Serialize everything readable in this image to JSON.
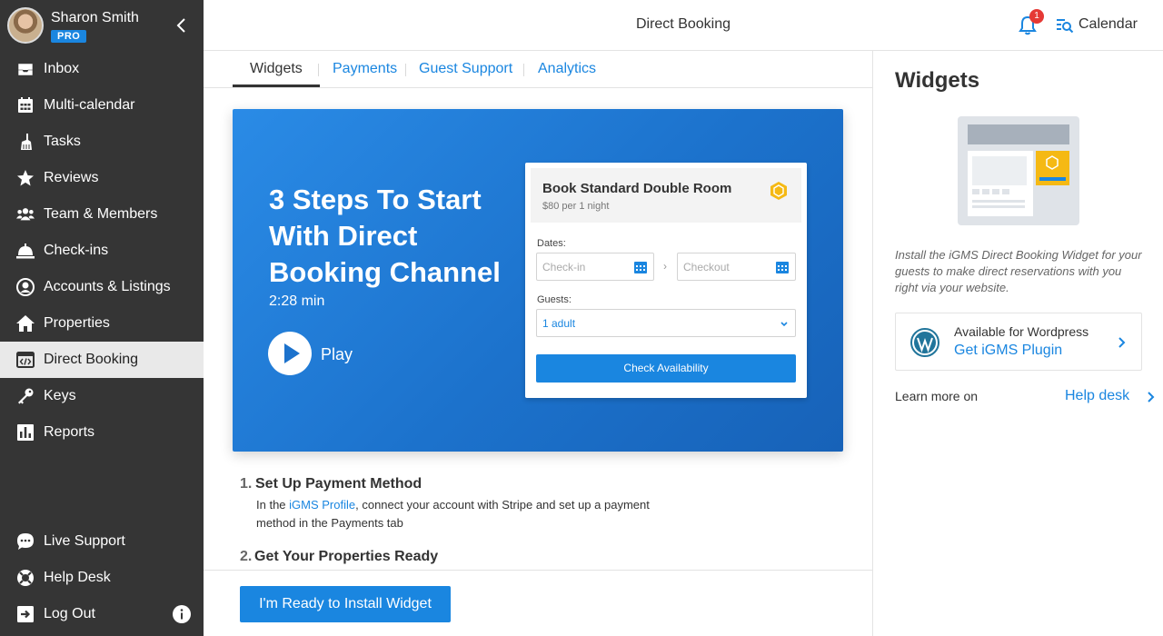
{
  "user": {
    "name": "Sharon Smith",
    "badge": "PRO"
  },
  "nav": {
    "items": [
      {
        "label": "Inbox",
        "icon": "inbox-icon"
      },
      {
        "label": "Multi-calendar",
        "icon": "calendar-grid-icon"
      },
      {
        "label": "Tasks",
        "icon": "broom-icon"
      },
      {
        "label": "Reviews",
        "icon": "star-icon"
      },
      {
        "label": "Team & Members",
        "icon": "users-icon"
      },
      {
        "label": "Check-ins",
        "icon": "service-bell-icon"
      },
      {
        "label": "Accounts & Listings",
        "icon": "account-circle-icon"
      },
      {
        "label": "Properties",
        "icon": "home-icon"
      },
      {
        "label": "Direct Booking",
        "icon": "browser-code-icon",
        "active": true
      },
      {
        "label": "Keys",
        "icon": "key-icon"
      },
      {
        "label": "Reports",
        "icon": "bar-chart-icon"
      }
    ],
    "bottom": [
      {
        "label": "Live Support",
        "icon": "chat-icon"
      },
      {
        "label": "Help Desk",
        "icon": "lifebuoy-icon"
      },
      {
        "label": "Log Out",
        "icon": "logout-icon"
      }
    ]
  },
  "header": {
    "title": "Direct Booking",
    "notification_count": "1",
    "calendar_label": "Calendar"
  },
  "tabs": [
    "Widgets",
    "Payments",
    "Guest Support",
    "Analytics"
  ],
  "hero": {
    "title": "3 Steps To Start With Direct Booking Channel",
    "duration": "2:28 min",
    "play_label": "Play",
    "widget": {
      "room": "Book Standard Double Room",
      "price": "$80 per 1 night",
      "dates_label": "Dates:",
      "checkin_placeholder": "Check-in",
      "checkout_placeholder": "Checkout",
      "guests_label": "Guests:",
      "guests_value": "1 adult",
      "button": "Check Availability"
    }
  },
  "steps": [
    {
      "number": "1.",
      "title": "Set Up Payment Method",
      "desc_before": "In the ",
      "desc_link": "iGMS Profile",
      "desc_after": ", connect your account with Stripe and set up a payment method in the Payments tab"
    },
    {
      "number": "2.",
      "title": "Get Your Properties Ready"
    }
  ],
  "footer": {
    "install_button": "I'm Ready to Install Widget"
  },
  "right_panel": {
    "title": "Widgets",
    "description": "Install the iGMS Direct Booking Widget for your guests to make direct reservations with you right via your website.",
    "wordpress_available": "Available for Wordpress",
    "wordpress_link": "Get iGMS Plugin",
    "learn_more": "Learn more on",
    "help_link": "Help desk"
  },
  "colors": {
    "accent": "#1a86e0",
    "sidebar": "#353535",
    "badge": "#e53935",
    "hero": "#1c72cc"
  }
}
